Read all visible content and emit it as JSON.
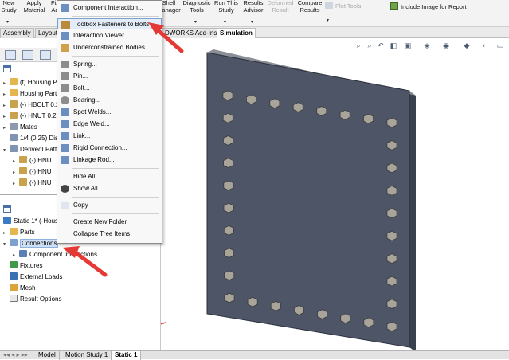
{
  "ribbon": {
    "buttons": [
      {
        "label": "New\nStudy",
        "icon": "new-study-icon"
      },
      {
        "label": "Apply\nMaterial",
        "icon": "material-icon"
      },
      {
        "label": "Fix\nAd",
        "icon": "fixture-icon"
      },
      {
        "label": "Shell\nManager",
        "icon": "shell-icon"
      },
      {
        "label": "Diagnostic\nTools",
        "icon": "diagnostic-icon"
      },
      {
        "label": "Run This\nStudy",
        "icon": "run-icon"
      },
      {
        "label": "Results\nAdvisor",
        "icon": "results-advisor-icon"
      },
      {
        "label": "Deformed\nResult",
        "icon": "deformed-icon",
        "disabled": true
      },
      {
        "label": "Compare\nResults",
        "icon": "compare-icon"
      },
      {
        "label": "Plot Tools",
        "icon": "plot-tools-icon",
        "disabled": true
      },
      {
        "label": "Include Image for Report",
        "icon": "report-image-icon"
      }
    ]
  },
  "tabs": {
    "items": [
      "Assembly",
      "Layout",
      "DWORKS Add-Ins",
      "Simulation"
    ],
    "active": "Simulation"
  },
  "feature_tree": {
    "items": [
      {
        "label": "(f) Housing P",
        "icon": "part-icon"
      },
      {
        "label": "Housing Part",
        "icon": "part-icon"
      },
      {
        "label": "(-) HBOLT 0.2",
        "icon": "bolt-icon"
      },
      {
        "label": "(-) HNUT 0.2",
        "icon": "nut-icon"
      },
      {
        "label": "Mates",
        "icon": "mates-icon"
      },
      {
        "label": "1/4 (0.25) Dis",
        "icon": "hole-icon"
      },
      {
        "label": "DerivedLPatt",
        "icon": "pattern-icon"
      },
      {
        "label": "(-) HNU",
        "icon": "nut-icon"
      },
      {
        "label": "(-) HNU",
        "icon": "nut-icon"
      },
      {
        "label": "(-) HNU",
        "icon": "nut-icon"
      }
    ]
  },
  "sim_tree": {
    "items": [
      {
        "label": "Static 1* (-Housing",
        "icon": "static-study-icon"
      },
      {
        "label": "Parts",
        "icon": "parts-icon"
      },
      {
        "label": "Connections",
        "icon": "connections-icon"
      },
      {
        "label": "Component Interactions",
        "icon": "component-interactions-icon"
      },
      {
        "label": "Fixtures",
        "icon": "fixtures-icon"
      },
      {
        "label": "External Loads",
        "icon": "loads-icon"
      },
      {
        "label": "Mesh",
        "icon": "mesh-icon"
      },
      {
        "label": "Result Options",
        "icon": "result-options-icon"
      }
    ]
  },
  "context_menu": {
    "items": [
      {
        "label": "Component Interaction...",
        "icon": "component-interaction-icon"
      },
      {
        "label": "Toolbox Fasteners to Bolts",
        "icon": "toolbox-bolt-icon",
        "highlighted": true
      },
      {
        "label": "Interaction Viewer...",
        "icon": "interaction-viewer-icon"
      },
      {
        "label": "Underconstrained Bodies...",
        "icon": "underconstrained-icon"
      },
      {
        "label": "Spring...",
        "icon": "spring-icon"
      },
      {
        "label": "Pin...",
        "icon": "pin-icon"
      },
      {
        "label": "Bolt...",
        "icon": "bolt-icon"
      },
      {
        "label": "Bearing...",
        "icon": "bearing-icon"
      },
      {
        "label": "Spot Welds...",
        "icon": "spot-weld-icon"
      },
      {
        "label": "Edge Weld...",
        "icon": "edge-weld-icon"
      },
      {
        "label": "Link...",
        "icon": "link-icon"
      },
      {
        "label": "Rigid Connection...",
        "icon": "rigid-connection-icon"
      },
      {
        "label": "Linkage Rod...",
        "icon": "linkage-rod-icon"
      },
      {
        "label": "Hide All",
        "icon": "hide-icon"
      },
      {
        "label": "Show All",
        "icon": "show-icon"
      },
      {
        "label": "Copy",
        "icon": "copy-icon"
      },
      {
        "label": "Create New Folder",
        "icon": "folder-icon"
      },
      {
        "label": "Collapse Tree Items",
        "icon": "collapse-icon"
      }
    ]
  },
  "bottom_tabs": {
    "items": [
      "Model",
      "Motion Study 1",
      "Static 1"
    ],
    "active": "Static 1"
  },
  "colors": {
    "arrow": "#e53935",
    "plate": "#4d5566",
    "bolt": "#a9a49a",
    "menu_highlight": "#e3ecf8"
  },
  "bolt_grid": {
    "rows": 10,
    "cols": 8
  }
}
